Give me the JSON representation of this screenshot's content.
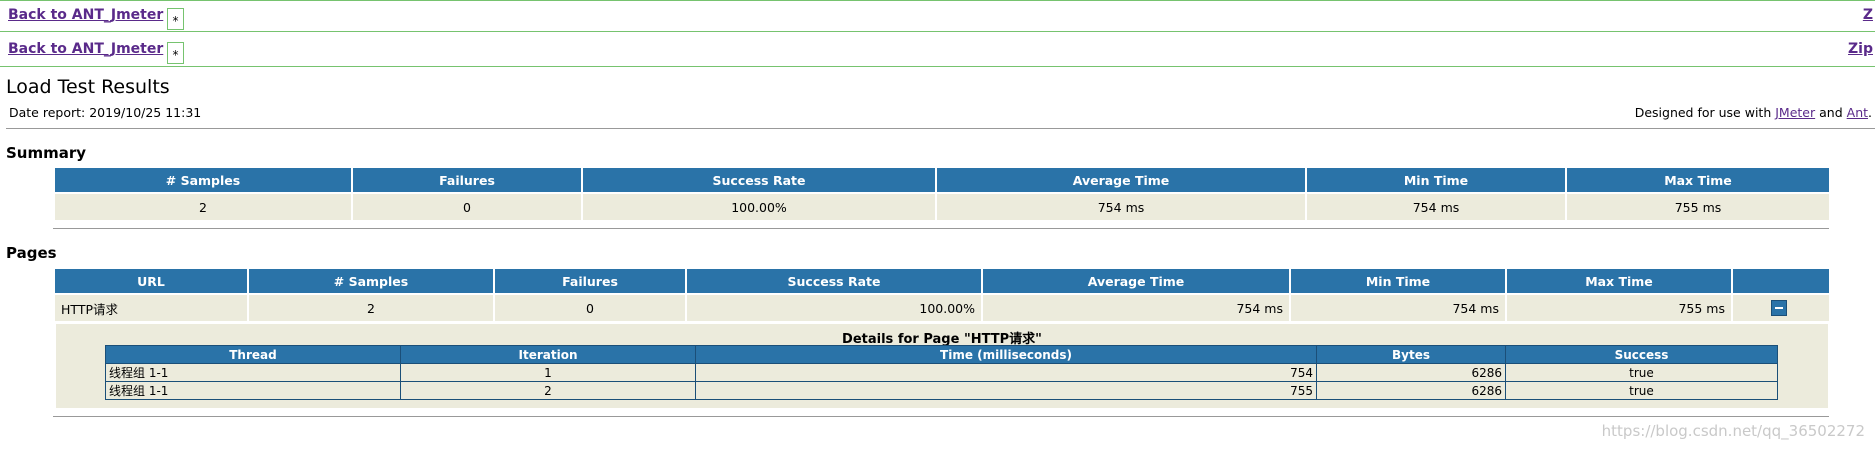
{
  "nav": {
    "back_label": "Back to ANT_Jmeter",
    "box_char": "*",
    "right_label_1": "Z",
    "right_label_2": "Zip"
  },
  "header": {
    "title": "Load Test Results",
    "date_report": "Date report: 2019/10/25 11:31",
    "designed_prefix": "Designed for use with",
    "jmeter_link": "JMeter",
    "and_text": "and",
    "ant_link": "Ant",
    "period": "."
  },
  "summary": {
    "heading": "Summary",
    "columns": [
      "# Samples",
      "Failures",
      "Success Rate",
      "Average Time",
      "Min Time",
      "Max Time"
    ],
    "row": [
      "2",
      "0",
      "100.00%",
      "754 ms",
      "754 ms",
      "755 ms"
    ]
  },
  "pages": {
    "heading": "Pages",
    "columns": [
      "URL",
      "# Samples",
      "Failures",
      "Success Rate",
      "Average Time",
      "Min Time",
      "Max Time"
    ],
    "row": [
      "HTTP请求",
      "2",
      "0",
      "100.00%",
      "754 ms",
      "754 ms",
      "755 ms"
    ]
  },
  "details": {
    "title": "Details for Page \"HTTP请求\"",
    "columns": [
      "Thread",
      "Iteration",
      "Time (milliseconds)",
      "Bytes",
      "Success"
    ],
    "rows": [
      [
        "线程组 1-1",
        "1",
        "754",
        "6286",
        "true"
      ],
      [
        "线程组 1-1",
        "2",
        "755",
        "6286",
        "true"
      ]
    ]
  },
  "watermark": "https://blog.csdn.net/qq_36502272",
  "colors": {
    "header_blue": "#2a73a8",
    "cell_beige": "#ecebdc",
    "nav_border_green": "#76c36f",
    "link_purple": "#5a2a8a"
  }
}
